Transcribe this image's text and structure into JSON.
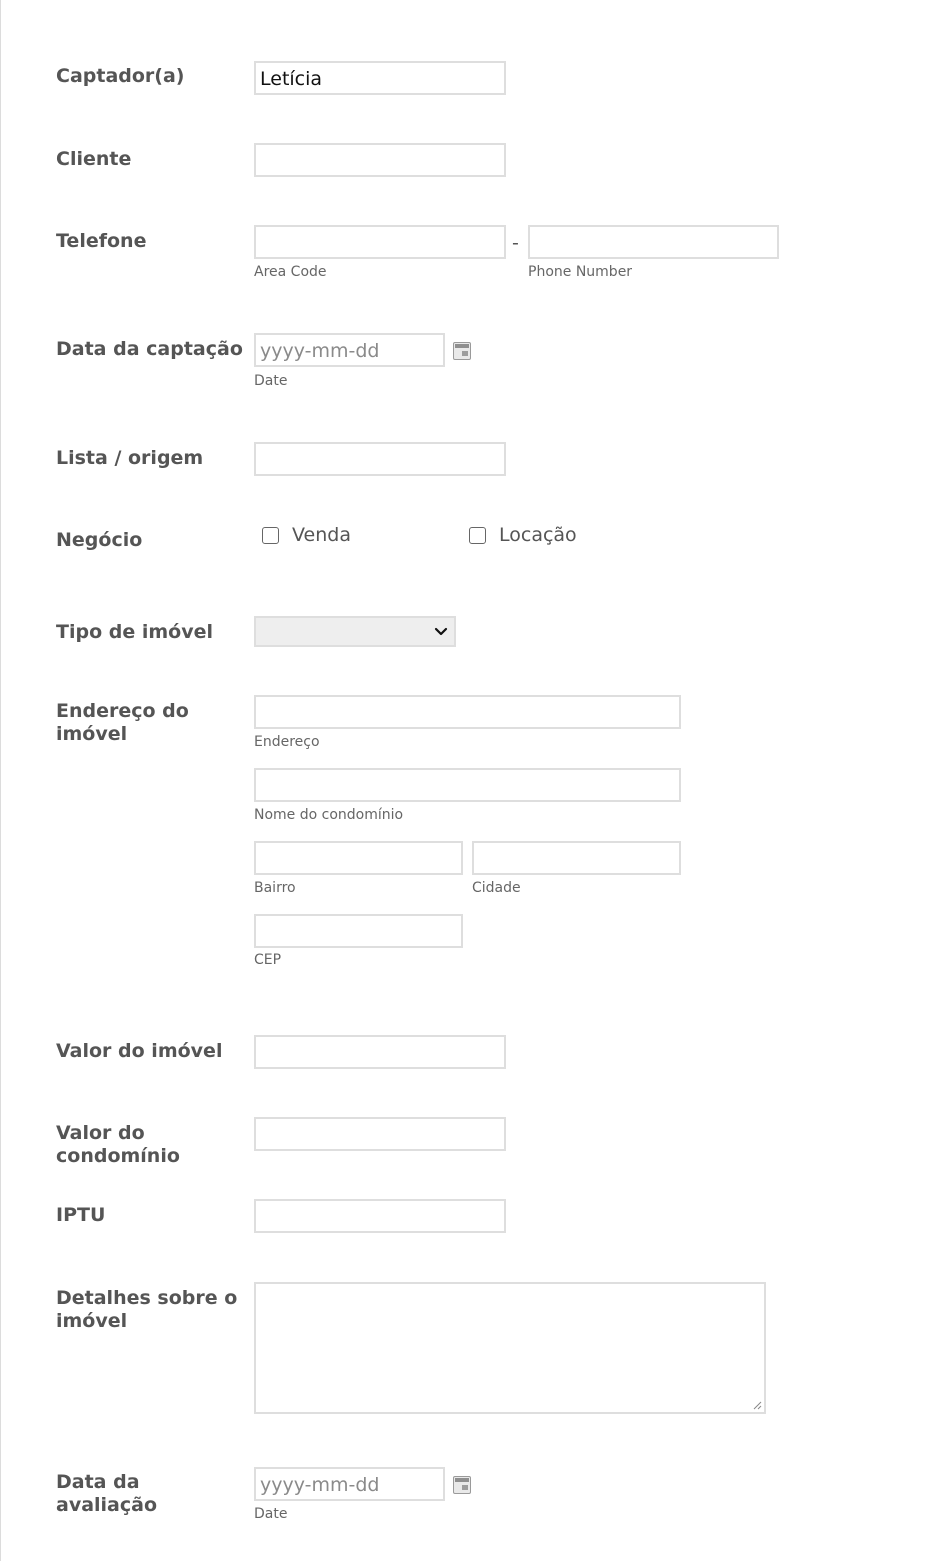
{
  "form": {
    "captador": {
      "label": "Captador(a)",
      "value": "Letícia"
    },
    "cliente": {
      "label": "Cliente",
      "value": ""
    },
    "telefone": {
      "label": "Telefone",
      "separator": "-",
      "area_code_sublabel": "Area Code",
      "phone_number_sublabel": "Phone Number"
    },
    "data_captacao": {
      "label": "Data da captação",
      "placeholder": "yyyy-mm-dd",
      "sublabel": "Date",
      "icon": "calendar-icon"
    },
    "lista_origem": {
      "label": "Lista / origem",
      "value": ""
    },
    "negocio": {
      "label": "Negócio",
      "options": [
        "Venda",
        "Locação"
      ]
    },
    "tipo_imovel": {
      "label": "Tipo de imóvel",
      "selected": ""
    },
    "endereco": {
      "label": "Endereço do imóvel",
      "sublabels": {
        "endereco": "Endereço",
        "condominio": "Nome do condomínio",
        "bairro": "Bairro",
        "cidade": "Cidade",
        "cep": "CEP"
      }
    },
    "valor_imovel": {
      "label": "Valor do imóvel",
      "value": ""
    },
    "valor_condominio": {
      "label": "Valor do condomínio",
      "value": ""
    },
    "iptu": {
      "label": "IPTU",
      "value": ""
    },
    "detalhes": {
      "label": "Detalhes sobre o imóvel",
      "value": ""
    },
    "data_avaliacao": {
      "label": "Data da avaliação",
      "placeholder": "yyyy-mm-dd",
      "sublabel": "Date",
      "icon": "calendar-icon"
    }
  },
  "colors": {
    "border": "#dedede",
    "label": "#555555",
    "sublabel": "#666666"
  }
}
